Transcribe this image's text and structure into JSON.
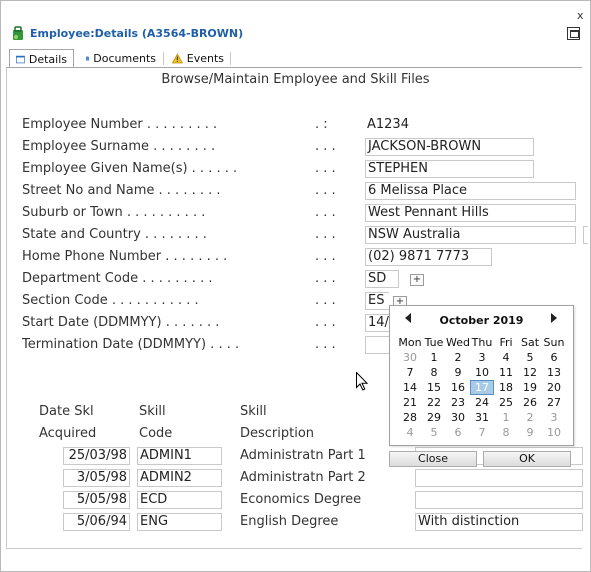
{
  "window": {
    "title": "Employee:Details (A3564-BROWN)",
    "close_glyph": "x",
    "subtitle": "Browse/Maintain Employee and Skill Files"
  },
  "tabs": [
    {
      "label": "Details",
      "icon": "window-icon",
      "active": true
    },
    {
      "label": "Documents",
      "icon": "document-icon"
    },
    {
      "label": "Events",
      "icon": "warning-icon"
    }
  ],
  "form": {
    "employee_number": {
      "label": "Employee Number . . . . . . . . .",
      "sep": ". :",
      "value": "A1234"
    },
    "surname": {
      "label": "Employee Surname . . . . . . . .",
      "sep": ". . .",
      "value": "JACKSON-BROWN"
    },
    "given_names": {
      "label": "Employee Given Name(s) . . . . . .",
      "sep": ". . .",
      "value": "STEPHEN"
    },
    "street": {
      "label": "Street No and Name . . . . . . . .",
      "sep": ". . .",
      "value": "6 Melissa Place"
    },
    "suburb": {
      "label": "Suburb or Town . . . . . . . . . .",
      "sep": ". . .",
      "value": "West Pennant Hills"
    },
    "state": {
      "label": "State and Country . . . . . . . .",
      "sep": ". . .",
      "value": "NSW Australia"
    },
    "phone": {
      "label": "Home Phone Number . . . . . . . .",
      "sep": ". . .",
      "value": "(02) 9871 7773"
    },
    "department": {
      "label": "Department Code . . . . . . . . .",
      "sep": ". . .",
      "value": "SD"
    },
    "section": {
      "label": "Section Code . . . . . . . . . . .",
      "sep": ". . .",
      "value": "ES"
    },
    "start_date": {
      "label": "Start Date (DDMMYY) . . . . . . .",
      "sep": ". . .",
      "value": "14/"
    },
    "termination_date": {
      "label": "Termination Date (DDMMYY) . . . .",
      "sep": ". . .",
      "value": ""
    }
  },
  "skills": {
    "headers": {
      "date_line1": "Date Skl",
      "date_line2": "Acquired",
      "code_line1": "Skill",
      "code_line2": "Code",
      "desc_line1": "Skill",
      "desc_line2": "Description"
    },
    "rows": [
      {
        "date": "25/03/98",
        "code": "ADMIN1",
        "description": "Administratn Part 1",
        "comment": ""
      },
      {
        "date": "3/05/98",
        "code": "ADMIN2",
        "description": "Administratn Part 2",
        "comment": ""
      },
      {
        "date": "5/05/98",
        "code": "ECD",
        "description": "Economics Degree",
        "comment": ""
      },
      {
        "date": "5/06/94",
        "code": "ENG",
        "description": "English Degree",
        "comment": "With distinction"
      }
    ]
  },
  "calendar": {
    "month_label": "October 2019",
    "weekdays": [
      "Mon",
      "Tue",
      "Wed",
      "Thu",
      "Fri",
      "Sat",
      "Sun"
    ],
    "days": [
      {
        "d": "30",
        "other": true
      },
      {
        "d": "1"
      },
      {
        "d": "2"
      },
      {
        "d": "3"
      },
      {
        "d": "4"
      },
      {
        "d": "5"
      },
      {
        "d": "6"
      },
      {
        "d": "7"
      },
      {
        "d": "8"
      },
      {
        "d": "9"
      },
      {
        "d": "10"
      },
      {
        "d": "11"
      },
      {
        "d": "12"
      },
      {
        "d": "13"
      },
      {
        "d": "14"
      },
      {
        "d": "15"
      },
      {
        "d": "16"
      },
      {
        "d": "17",
        "selected": true
      },
      {
        "d": "18"
      },
      {
        "d": "19"
      },
      {
        "d": "20"
      },
      {
        "d": "21"
      },
      {
        "d": "22"
      },
      {
        "d": "23"
      },
      {
        "d": "24"
      },
      {
        "d": "25"
      },
      {
        "d": "26"
      },
      {
        "d": "27"
      },
      {
        "d": "28"
      },
      {
        "d": "29"
      },
      {
        "d": "30"
      },
      {
        "d": "31"
      },
      {
        "d": "1",
        "other": true
      },
      {
        "d": "2",
        "other": true
      },
      {
        "d": "3",
        "other": true
      },
      {
        "d": "4",
        "other": true
      },
      {
        "d": "5",
        "other": true
      },
      {
        "d": "6",
        "other": true
      },
      {
        "d": "7",
        "other": true
      },
      {
        "d": "8",
        "other": true
      },
      {
        "d": "9",
        "other": true
      },
      {
        "d": "10",
        "other": true
      }
    ],
    "close_label": "Close",
    "ok_label": "OK"
  },
  "colors": {
    "title": "#1f5fa8",
    "selected_day": "#a8cbe8",
    "icon_green": "#2e9a3c"
  }
}
